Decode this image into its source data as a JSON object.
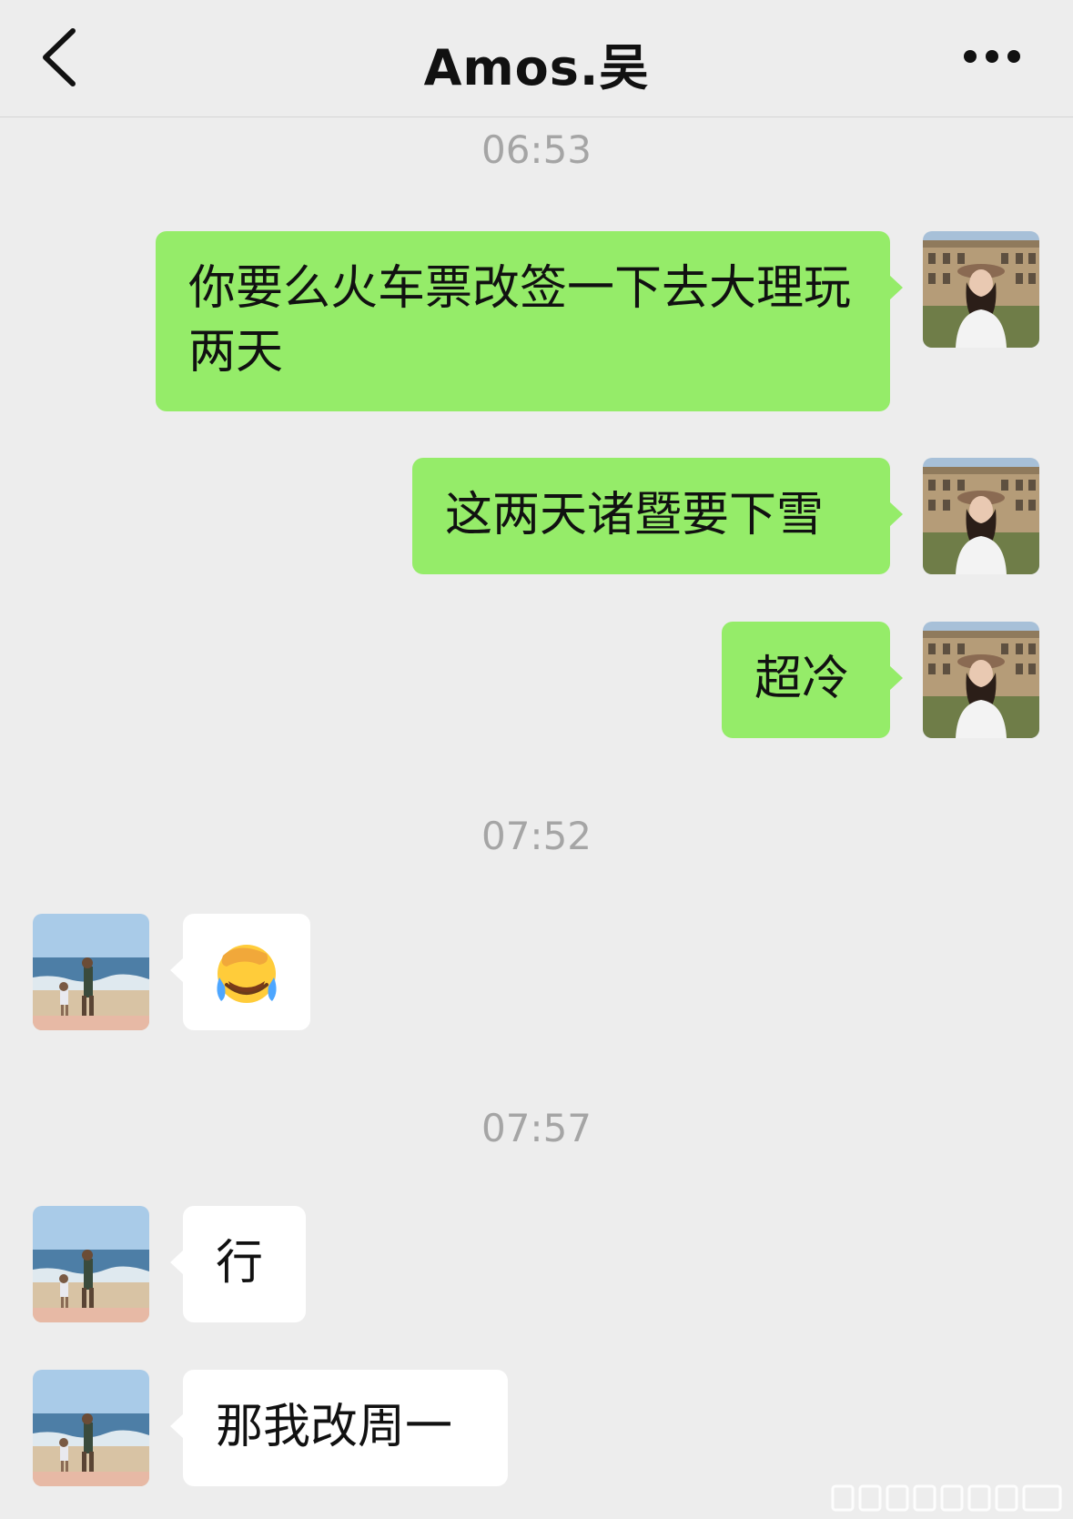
{
  "header": {
    "title": "Amos.吴",
    "back_icon": "chevron-left-icon",
    "more_icon": "ellipsis-icon"
  },
  "messages": [
    {
      "time": "06:53"
    },
    {
      "side": "me",
      "text": "你要么火车票改签一下去大理玩两天"
    },
    {
      "side": "me",
      "text": "这两天诸暨要下雪"
    },
    {
      "side": "me",
      "text": "超冷"
    },
    {
      "time": "07:52"
    },
    {
      "side": "other",
      "emoji": "face-with-hand-over-eyes-crying-emoji"
    },
    {
      "time": "07:57"
    },
    {
      "side": "other",
      "text": "行"
    },
    {
      "side": "other",
      "text": "那我改周一"
    }
  ],
  "avatars": {
    "me": "avatar-woman-castle",
    "other": "avatar-beach"
  },
  "colors": {
    "background": "#ededed",
    "my_bubble": "#95ec69",
    "their_bubble": "#ffffff",
    "timestamp": "#a5a5a5"
  }
}
